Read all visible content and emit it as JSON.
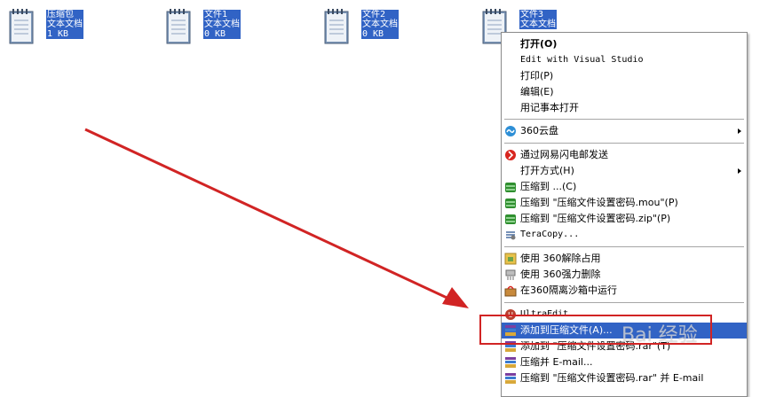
{
  "files": [
    {
      "name": "压缩包",
      "type": "文本文档",
      "size": "1 KB"
    },
    {
      "name": "文件1",
      "type": "文本文档",
      "size": "0 KB"
    },
    {
      "name": "文件2",
      "type": "文本文档",
      "size": "0 KB"
    },
    {
      "name": "文件3",
      "type": "文本文档",
      "size": ""
    }
  ],
  "menu": {
    "open": "打开(O)",
    "edit_vs": "Edit with Visual Studio",
    "print": "打印(P)",
    "edit": "编辑(E)",
    "notepad": "用记事本打开",
    "cloud360": "360云盘",
    "netease": "通过网易闪电邮发送",
    "open_with": "打开方式(H)",
    "compress_to": "压缩到 ...(C)",
    "compress_mou": "压缩到 \"压缩文件设置密码.mou\"(P)",
    "compress_zip": "压缩到 \"压缩文件设置密码.zip\"(P)",
    "teracopy": "TeraCopy...",
    "unlock360": "使用 360解除占用",
    "delete360": "使用 360强力删除",
    "sandbox360": "在360隔离沙箱中运行",
    "ultraedit": "UltraEdit",
    "add_archive": "添加到压缩文件(A)...",
    "add_rar": "添加到 \"压缩文件设置密码.rar\"(T)",
    "compress_email": "压缩并 E-mail...",
    "compress_rar_email": "压缩到 \"压缩文件设置密码.rar\" 并 E-mail"
  },
  "watermark": "Bai 经验",
  "colors": {
    "selection": "#3163c5",
    "annotation_red": "#d12424"
  }
}
